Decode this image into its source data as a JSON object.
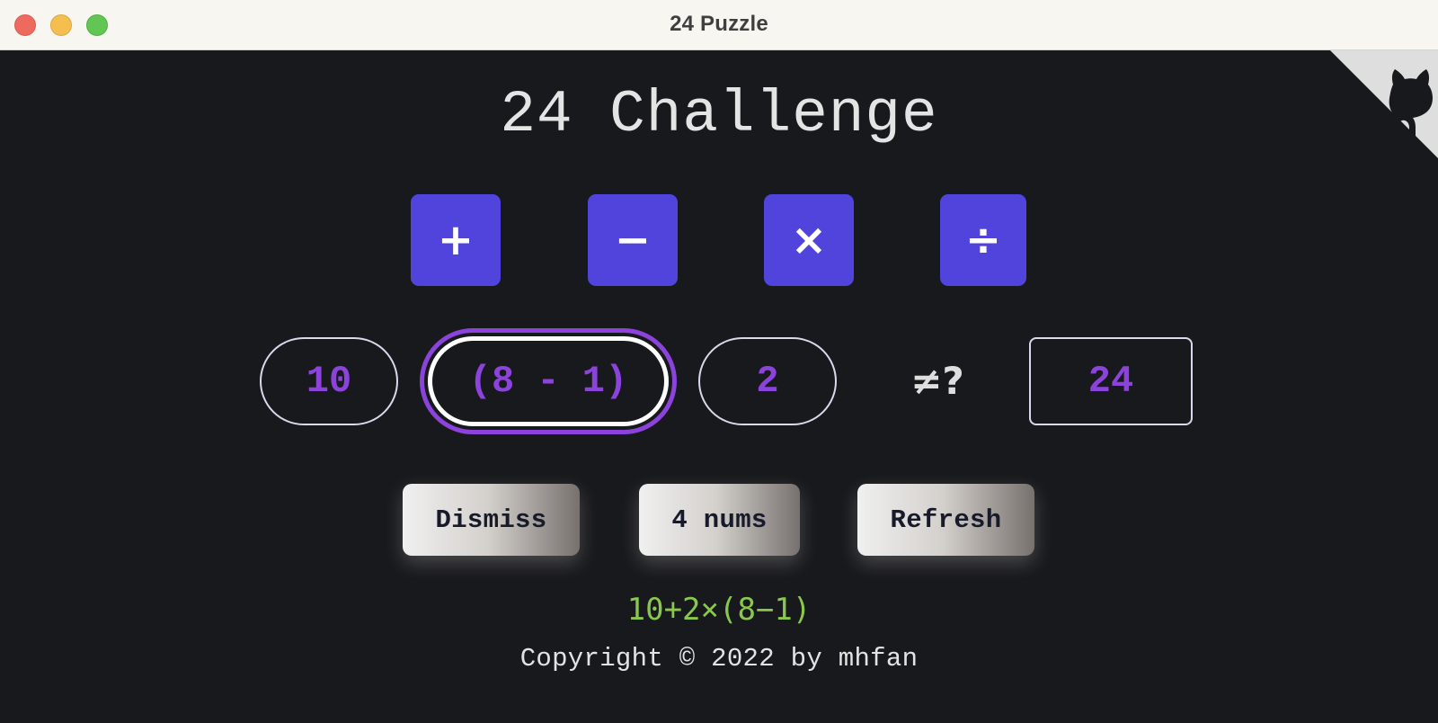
{
  "window": {
    "title": "24 Puzzle"
  },
  "corner_link": {
    "icon": "github-icon"
  },
  "heading": "24 Challenge",
  "operators": [
    {
      "label": "+",
      "name": "plus"
    },
    {
      "label": "−",
      "name": "minus"
    },
    {
      "label": "×",
      "name": "times"
    },
    {
      "label": "÷",
      "name": "divide"
    }
  ],
  "numbers": [
    "10",
    "(8 - 1)",
    "2"
  ],
  "comparison": "≠?",
  "target": "24",
  "actions": {
    "dismiss": "Dismiss",
    "nums": "4 nums",
    "refresh": "Refresh"
  },
  "solution": "10+2×(8−1)",
  "copyright": "Copyright © 2022 by mhfan",
  "colors": {
    "operator": "#5044dd",
    "number_text": "#8c43dc",
    "solution": "#8ac84d",
    "background": "#18191c"
  }
}
